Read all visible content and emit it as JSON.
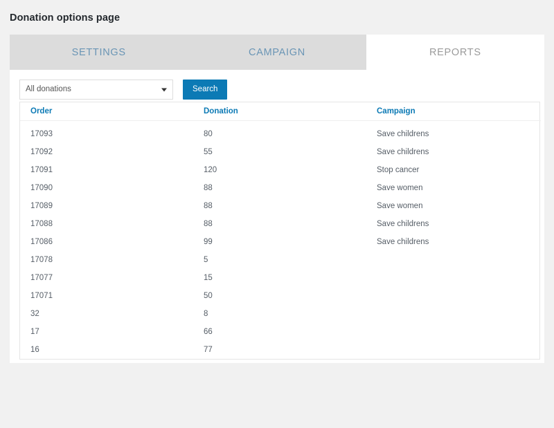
{
  "page": {
    "title": "Donation options page",
    "background_color": "#f1f1f1",
    "card_background": "#ffffff"
  },
  "colors": {
    "accent_blue": "#0c7ab5",
    "tab_inactive_bg": "#dcdcdc",
    "tab_inactive_text": "#6a95b5",
    "tab_active_text": "#9b9b9b",
    "link_blue": "#4a7eab",
    "body_text": "#555d66"
  },
  "tabs": [
    {
      "label": "SETTINGS",
      "active": false
    },
    {
      "label": "CAMPAIGN",
      "active": false
    },
    {
      "label": "REPORTS",
      "active": true
    }
  ],
  "filter": {
    "select_value": "All donations",
    "select_options": [
      "All donations"
    ],
    "caret_icon": "chevron-down-icon",
    "search_label": "Search"
  },
  "table": {
    "columns": [
      "Order",
      "Donation",
      "Campaign"
    ],
    "rows": [
      {
        "order": "17093",
        "donation": "80",
        "campaign": "Save childrens"
      },
      {
        "order": "17092",
        "donation": "55",
        "campaign": "Save childrens"
      },
      {
        "order": "17091",
        "donation": "120",
        "campaign": "Stop cancer"
      },
      {
        "order": "17090",
        "donation": "88",
        "campaign": "Save women"
      },
      {
        "order": "17089",
        "donation": "88",
        "campaign": "Save women"
      },
      {
        "order": "17088",
        "donation": "88",
        "campaign": "Save childrens"
      },
      {
        "order": "17086",
        "donation": "99",
        "campaign": "Save childrens"
      },
      {
        "order": "17078",
        "donation": "5",
        "campaign": ""
      },
      {
        "order": "17077",
        "donation": "15",
        "campaign": ""
      },
      {
        "order": "17071",
        "donation": "50",
        "campaign": ""
      },
      {
        "order": "32",
        "donation": "8",
        "campaign": ""
      },
      {
        "order": "17",
        "donation": "66",
        "campaign": ""
      },
      {
        "order": "16",
        "donation": "77",
        "campaign": ""
      }
    ]
  }
}
